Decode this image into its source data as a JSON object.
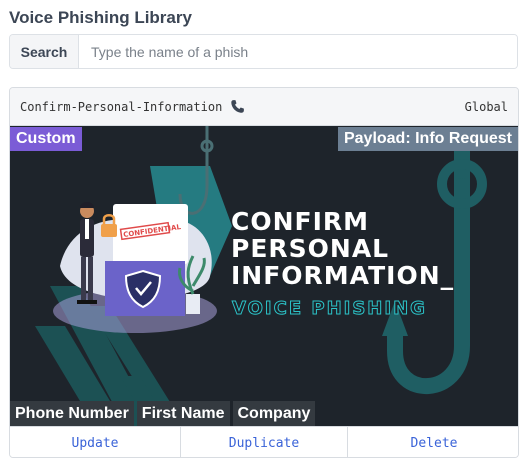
{
  "page": {
    "title": "Voice Phishing Library"
  },
  "search": {
    "label": "Search",
    "placeholder": "Type the name of a phish",
    "value": ""
  },
  "card": {
    "name": "Confirm-Personal-Information",
    "scope": "Global",
    "type_icon": "phone-icon",
    "badges": {
      "category": "Custom",
      "payload": "Payload: Info Request"
    },
    "banner": {
      "lines": [
        "CONFIRM",
        "PERSONAL",
        "INFORMATION_"
      ],
      "subtitle": "VOICE PHISHING",
      "doc_stamp": "CONFIDENTIAL",
      "icons": [
        "businessman-figure",
        "shield-check-icon",
        "fishing-hook-icon",
        "lock-icon",
        "plant-icon"
      ]
    },
    "tags": [
      "Phone Number",
      "First Name",
      "Company"
    ],
    "actions": {
      "update": "Update",
      "duplicate": "Duplicate",
      "delete": "Delete"
    }
  },
  "colors": {
    "accent_purple": "#7b5cd6",
    "payload_gray": "#6c7f93",
    "tag_dark": "#343a40",
    "teal": "#2cc3c8",
    "link_blue": "#3a63d8"
  }
}
